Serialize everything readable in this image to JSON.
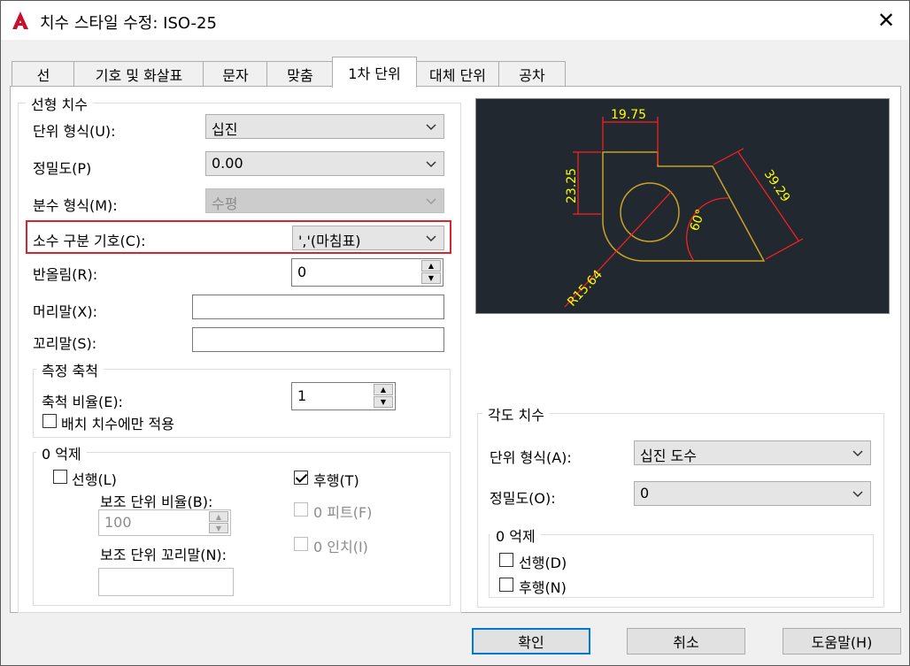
{
  "window": {
    "title": "치수 스타일 수정: ISO-25",
    "close_glyph": "✕"
  },
  "tabs": [
    "선",
    "기호 및 화살표",
    "문자",
    "맞춤",
    "1차 단위",
    "대체 단위",
    "공차"
  ],
  "linear": {
    "group_title": "선형 치수",
    "unit_format_label": "단위 형식(U):",
    "unit_format_value": "십진",
    "precision_label": "정밀도(P)",
    "precision_value": "0.00",
    "fraction_label": "분수 형식(M):",
    "fraction_value": "수평",
    "decimal_sep_label": "소수 구분 기호(C):",
    "decimal_sep_value": "','(마침표)",
    "round_label": "반올림(R):",
    "round_value": "0",
    "prefix_label": "머리말(X):",
    "prefix_value": "",
    "suffix_label": "꼬리말(S):",
    "suffix_value": ""
  },
  "scale": {
    "group_title": "측정 축척",
    "factor_label": "축척 비율(E):",
    "factor_value": "1",
    "layout_only_label": "배치 치수에만 적용",
    "layout_only_checked": false
  },
  "zero_linear": {
    "group_title": "0 억제",
    "leading_label": "선행(L)",
    "leading_checked": false,
    "trailing_label": "후행(T)",
    "trailing_checked": true,
    "sub_factor_label": "보조 단위 비율(B):",
    "sub_factor_value": "100",
    "sub_suffix_label": "보조 단위 꼬리말(N):",
    "sub_suffix_value": "",
    "feet_label": "0 피트(F)",
    "inch_label": "0 인치(I)"
  },
  "preview": {
    "dim_top": "19.75",
    "dim_left": "23.25",
    "dim_right": "39.29",
    "dim_angle": "60°",
    "dim_radius": "R15.64",
    "line_color": "#c9a227",
    "text_color": "#ffff00",
    "dim_color": "#ff2020",
    "bg_color": "#212830"
  },
  "angular": {
    "group_title": "각도 치수",
    "unit_format_label": "단위 형식(A):",
    "unit_format_value": "십진 도수",
    "precision_label": "정밀도(O):",
    "precision_value": "0"
  },
  "zero_angular": {
    "group_title": "0 억제",
    "leading_label": "선행(D)",
    "leading_checked": false,
    "trailing_label": "후행(N)",
    "trailing_checked": false
  },
  "buttons": {
    "ok": "확인",
    "cancel": "취소",
    "help": "도움말(H)"
  },
  "colors": {
    "highlight": "#d8262e",
    "default_button_border": "#0078d7"
  }
}
